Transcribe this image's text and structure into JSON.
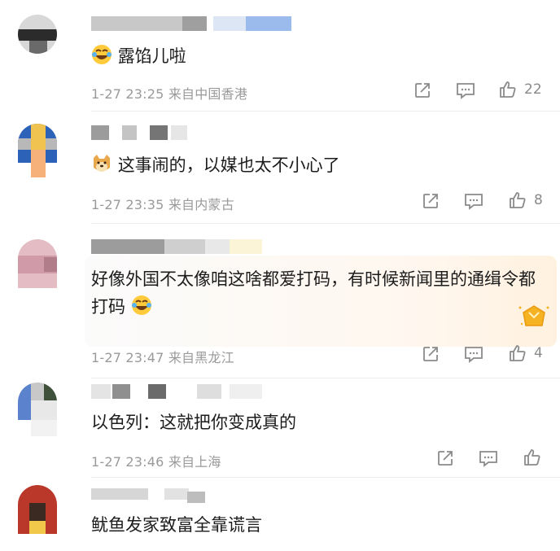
{
  "comments": [
    {
      "text": "露馅儿啦",
      "emoji": "laugh-cry",
      "time": "1-27 23:25",
      "location": "来自中国香港",
      "likes": "22"
    },
    {
      "text": "这事闹的，以媒也太不小心了",
      "emoji": "doge",
      "time": "1-27 23:35",
      "location": "来自内蒙古",
      "likes": "8"
    },
    {
      "text": "好像外国不太像咱这啥都爱打码，有时候新闻里的通缉令都打码",
      "emoji": "laugh-cry",
      "time": "1-27 23:47",
      "location": "来自黑龙江",
      "likes": "4"
    },
    {
      "text": "以色列：这就把你变成真的",
      "time": "1-27 23:46",
      "location": "来自上海",
      "likes": ""
    },
    {
      "text": "鱿鱼发家致富全靠谎言"
    }
  ],
  "icons": {
    "repost": "share-icon",
    "comment": "comment-icon",
    "like": "thumbs-up-icon",
    "badge": "crown-badge-icon"
  },
  "colors": {
    "text": "#1c1c1c",
    "meta": "#9a9a9a",
    "icon": "#8a8a8a",
    "divider": "#ececec",
    "badge": "#f5b324"
  }
}
